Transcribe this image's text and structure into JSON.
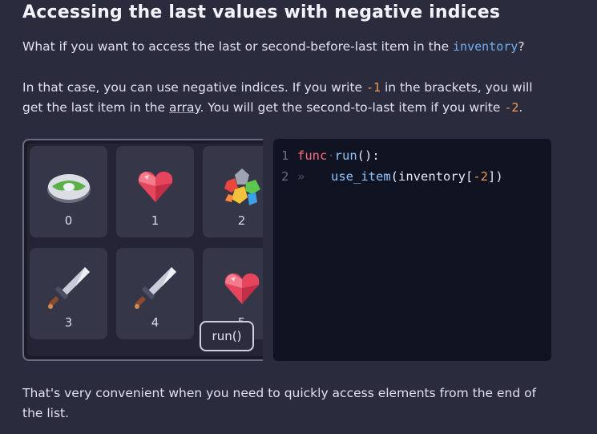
{
  "heading": "Accessing the last values with negative indices",
  "para1": {
    "before": "What if you want to access the last or second-before-last item in the ",
    "code": "inventory",
    "after": "?"
  },
  "para2": {
    "line1_before": "In that case, you can use negative indices. If you write ",
    "line1_code": "-1",
    "line1_after": " in the brackets, you will",
    "line2_before": "get the last item in the ",
    "line2_link": "array",
    "line2_middle": ". You will get the second-to-last item if you write ",
    "line2_code": "-2",
    "line2_after": "."
  },
  "inventory": {
    "slots": [
      {
        "label": "0",
        "item": "shield-disc-icon"
      },
      {
        "label": "1",
        "item": "heart-gem-icon"
      },
      {
        "label": "2",
        "item": "gem-cluster-icon"
      },
      {
        "label": "3",
        "item": "sword-icon"
      },
      {
        "label": "4",
        "item": "sword-icon"
      },
      {
        "label": "5",
        "item": "heart-gem-icon"
      }
    ],
    "run_label": "run()"
  },
  "editor": {
    "lines": [
      {
        "num": "1",
        "kw": "func",
        "rest_fn": "run",
        "rest": "():"
      },
      {
        "num": "2",
        "indent": "»",
        "fn": "use_item",
        "open": "(inventory[",
        "num_lit": "-2",
        "close": "])"
      }
    ]
  },
  "para3": {
    "line1": "That's very convenient when you need to quickly access elements from the end of",
    "line2": "the list."
  },
  "colors": {
    "background": "#2b2b3e",
    "code_keyword": "#ff6b7a",
    "code_function": "#8ec7ff",
    "code_number": "#f29b57",
    "inline_code": "#6fb0f5"
  }
}
